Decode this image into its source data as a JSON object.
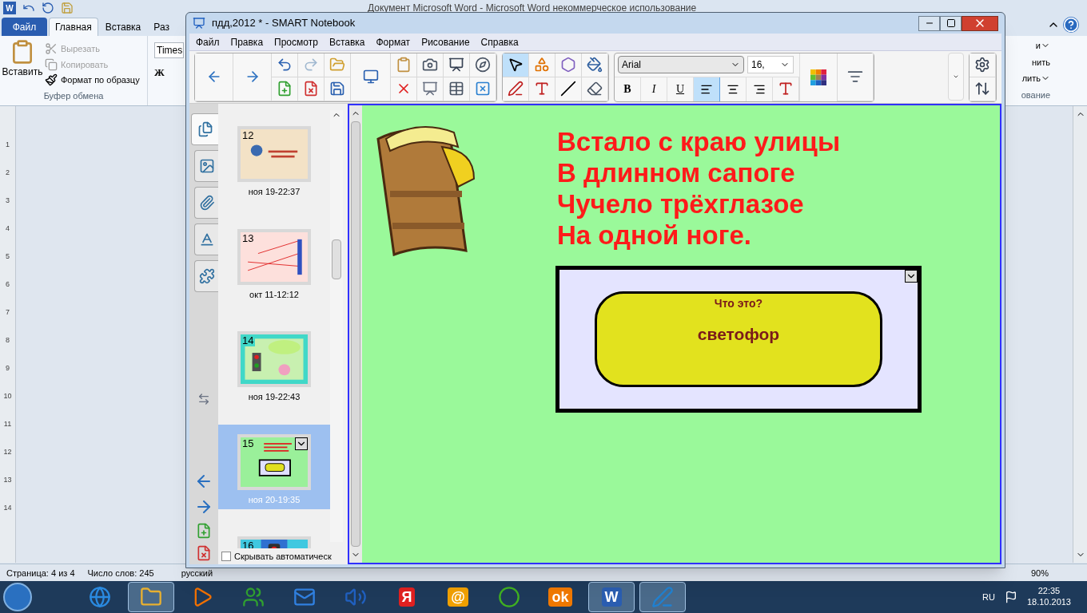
{
  "word": {
    "app_icon": "W",
    "title": "Документ Microsoft Word - Microsoft Word некоммерческое использование",
    "tabs": [
      {
        "label": "Файл",
        "kind": "file",
        "selected": false
      },
      {
        "label": "Главная",
        "kind": "tab",
        "selected": true
      },
      {
        "label": "Вставка",
        "kind": "tab",
        "selected": false
      },
      {
        "label": "Раз",
        "kind": "tab",
        "selected": false
      }
    ],
    "paste": "Вставить",
    "clipboard": [
      {
        "label": "Вырезать",
        "disabled": true
      },
      {
        "label": "Копировать",
        "disabled": true
      },
      {
        "label": "Формат по образцу",
        "disabled": false
      }
    ],
    "group_label": "Буфер обмена",
    "font_field": "Times",
    "bold": "Ж",
    "right_fragments": [
      {
        "label": "и",
        "caret": true
      },
      {
        "label": "нить",
        "caret": false
      },
      {
        "label": "лить",
        "caret": true
      },
      {
        "label": "ование",
        "caret": false
      }
    ],
    "ruler_marks": [
      "1",
      "2",
      "3",
      "4",
      "5",
      "6",
      "7",
      "8",
      "9",
      "10",
      "11",
      "12",
      "13",
      "14"
    ],
    "status_bar": {
      "page": "Страница: 4 из 4",
      "words": "Число слов: 245",
      "language": "русский",
      "zoom": "90%"
    }
  },
  "notebook": {
    "title": "пдд,2012 * - SMART Notebook",
    "menu": [
      "Файл",
      "Правка",
      "Просмотр",
      "Вставка",
      "Формат",
      "Рисование",
      "Справка"
    ],
    "tools": [
      {
        "kind": "select",
        "selected": true
      },
      {
        "kind": "shapes",
        "selected": false
      },
      {
        "kind": "polygons",
        "selected": false
      },
      {
        "kind": "fill",
        "selected": false
      },
      {
        "kind": "pens",
        "selected": false
      },
      {
        "kind": "text",
        "selected": false
      },
      {
        "kind": "line",
        "selected": false
      },
      {
        "kind": "eraser",
        "selected": false
      }
    ],
    "font": "Arial",
    "size": "16,",
    "format": [
      {
        "kind": "bold",
        "label": "B",
        "selected": false
      },
      {
        "kind": "italic",
        "label": "I",
        "selected": false
      },
      {
        "kind": "underline",
        "label": "U",
        "selected": false
      },
      {
        "kind": "align-left",
        "selected": true
      },
      {
        "kind": "align-center",
        "selected": false
      },
      {
        "kind": "align-right",
        "selected": false
      }
    ],
    "side_tabs": [
      {
        "kind": "pages",
        "selected": true
      },
      {
        "kind": "gallery",
        "selected": false
      },
      {
        "kind": "attachments",
        "selected": false
      },
      {
        "kind": "properties",
        "selected": false
      },
      {
        "kind": "addons",
        "selected": false
      }
    ],
    "pages": [
      {
        "number": "12",
        "date": "ноя 19-22:37",
        "kind": "tan",
        "selected": false
      },
      {
        "number": "13",
        "date": "окт 11-12:12",
        "kind": "pink",
        "selected": false
      },
      {
        "number": "14",
        "date": "ноя 19-22:43",
        "kind": "teal",
        "selected": false
      },
      {
        "number": "15",
        "date": "ноя 20-19:35",
        "kind": "green",
        "selected": true
      },
      {
        "number": "16",
        "kind": "blue",
        "selected": false
      }
    ],
    "autohide": {
      "label": "Скрывать автоматическ",
      "checked": false
    },
    "poem": [
      "Встало с краю улицы",
      "В длинном сапоге",
      "Чучело трёхглазое",
      "На одной ноге."
    ],
    "card": {
      "question": "Что это?",
      "answer": "светофор"
    }
  },
  "taskbar": {
    "apps": [
      {
        "kind": "ie",
        "selected": false
      },
      {
        "kind": "explorer",
        "selected": true
      },
      {
        "kind": "media",
        "selected": false
      },
      {
        "kind": "messenger",
        "selected": false
      },
      {
        "kind": "mail",
        "selected": false
      },
      {
        "kind": "speaker",
        "selected": false
      },
      {
        "kind": "letter",
        "glyph": "Я",
        "color": "#e02020",
        "selected": false
      },
      {
        "kind": "letter",
        "glyph": "@",
        "color": "#f0a000",
        "selected": false
      },
      {
        "kind": "ball",
        "selected": false
      },
      {
        "kind": "letter",
        "glyph": "ok",
        "color": "#f07800",
        "selected": false
      },
      {
        "kind": "letter",
        "glyph": "W",
        "color": "#2a5db0",
        "selected": true
      },
      {
        "kind": "notebook",
        "selected": true
      }
    ],
    "language": "RU",
    "time": "22:35",
    "date": "18.10.2013"
  }
}
